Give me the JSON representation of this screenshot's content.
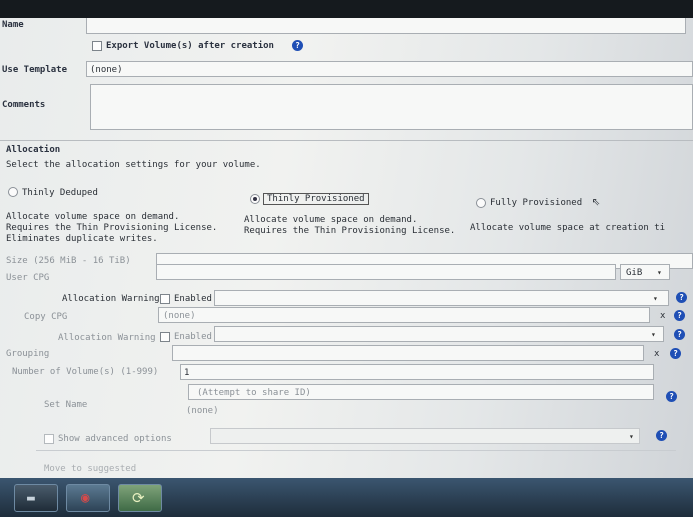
{
  "form": {
    "name_label": "Name",
    "export_label": "Export Volume(s) after creation",
    "use_template_label": "Use Template",
    "use_template_value": "(none)",
    "comments_label": "Comments"
  },
  "allocation": {
    "section_title": "Allocation",
    "instruction": "Select the allocation settings for your volume.",
    "options": [
      {
        "label": "Thinly Deduped",
        "desc1": "Allocate volume space on demand.",
        "desc2": "Requires the Thin Provisioning License.",
        "desc3": "Eliminates duplicate writes.",
        "selected": false
      },
      {
        "label": "Thinly Provisioned",
        "desc1": "Allocate volume space on demand.",
        "desc2": "Requires the Thin Provisioning License.",
        "desc3": "",
        "selected": true
      },
      {
        "label": "Fully Provisioned",
        "desc1": "Allocate volume space at creation ti",
        "desc2": "",
        "desc3": "",
        "selected": false
      }
    ]
  },
  "fields": {
    "size_label": "Size (256 MiB - 16 TiB)",
    "size_unit": "GiB",
    "user_cpg_label": "User CPG",
    "alloc_warning_label": "Allocation Warning",
    "enabled_label": "Enabled",
    "copy_cpg_label": "Copy CPG",
    "copy_cpg_value": "(none)",
    "alloc_warning2_label": "Allocation Warning",
    "enabled2_label": "Enabled",
    "grouping_label": "Grouping",
    "num_volumes_label": "Number of Volume(s) (1-999)",
    "num_volumes_value": "1",
    "set_name_label": "Set Name",
    "set_name_placeholder": "(Attempt to share ID)",
    "set_name_value": "(none)",
    "show_advanced_label": "Show advanced options",
    "footer_faded": "Move to suggested"
  },
  "icons": {
    "help": "question-help-icon",
    "dropdown": "chevron-down-icon",
    "clear": "clear-x-icon"
  },
  "colors": {
    "help_blue": "#1f4fb5",
    "taskbar": "#2d4356"
  }
}
